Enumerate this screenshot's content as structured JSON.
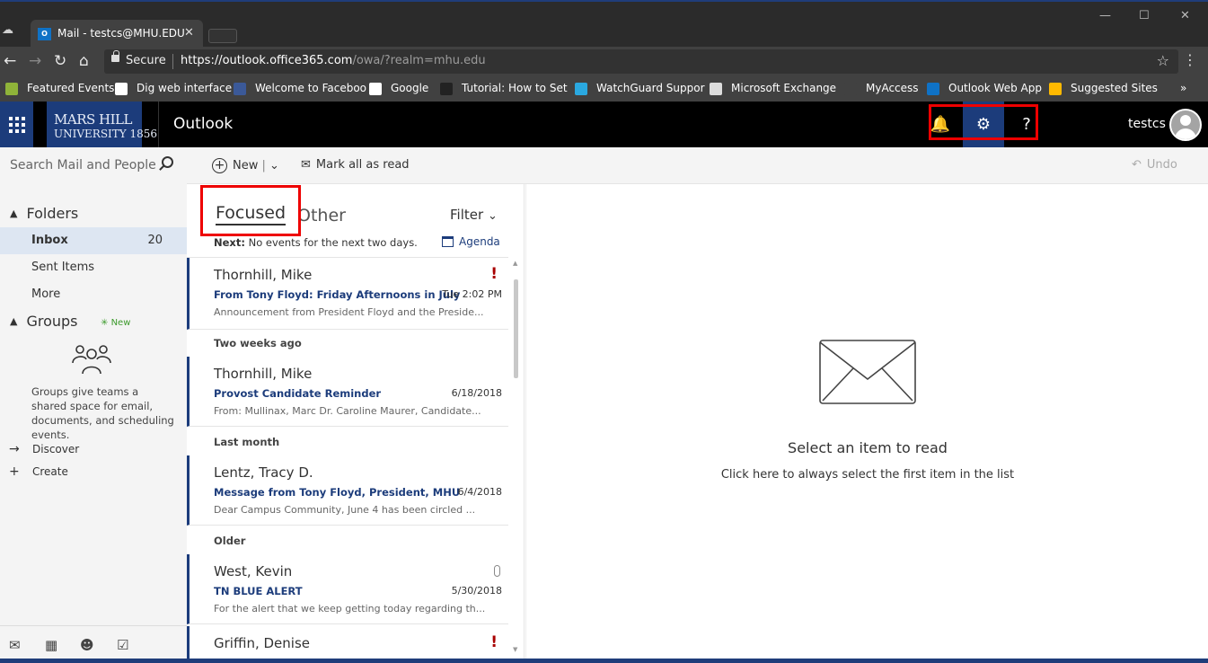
{
  "browser": {
    "tab_title": "Mail - testcs@MHU.EDU",
    "tab_favicon": "O",
    "secure_label": "Secure",
    "url_host": "https://outlook.office365.com",
    "url_path": "/owa/?realm=mhu.edu",
    "bookmarks": [
      {
        "label": "Featured Events",
        "icon": "bookmark-icon",
        "color": "#8fb339"
      },
      {
        "label": "Dig web interface",
        "icon": "dig-icon",
        "color": "#ffffff"
      },
      {
        "label": "Welcome to Faceboo",
        "icon": "facebook-icon",
        "color": "#3b5998"
      },
      {
        "label": "Google",
        "icon": "google-icon",
        "color": "#ffffff"
      },
      {
        "label": "Tutorial: How to Set",
        "icon": "tutorial-icon",
        "color": "#222222"
      },
      {
        "label": "WatchGuard Suppor",
        "icon": "cloud-icon",
        "color": "#2aa8e0"
      },
      {
        "label": "Microsoft Exchange",
        "icon": "page-icon",
        "color": "#dddddd"
      },
      {
        "label": "MyAccess",
        "icon": "myaccess-icon",
        "color": "#414141"
      },
      {
        "label": "Outlook Web App",
        "icon": "outlook-icon",
        "color": "#0f72c6"
      },
      {
        "label": "Suggested Sites",
        "icon": "bing-icon",
        "color": "#ffb900"
      }
    ],
    "more_bookmarks": "»"
  },
  "header": {
    "logo_line1": "MARS HILL",
    "logo_line2": "UNIVERSITY 1856",
    "app_name": "Outlook",
    "user_name": "testcs"
  },
  "sidebar": {
    "search_placeholder": "Search Mail and People",
    "folders_label": "Folders",
    "folders": [
      {
        "label": "Inbox",
        "count": "20"
      },
      {
        "label": "Sent Items",
        "count": ""
      },
      {
        "label": "More",
        "count": ""
      }
    ],
    "groups_label": "Groups",
    "groups_new": "New",
    "groups_text": "Groups give teams a shared space for email, documents, and scheduling events.",
    "discover_label": "Discover",
    "create_label": "Create"
  },
  "toolbar": {
    "new_label": "New",
    "mark_all_read": "Mark all as read",
    "undo": "Undo"
  },
  "list": {
    "focused_tab": "Focused",
    "other_tab": "Other",
    "filter_label": "Filter",
    "next_label": "Next:",
    "next_text": "No events for the next two days.",
    "agenda_label": "Agenda",
    "groups": [
      "Two weeks ago",
      "Last month",
      "Older"
    ],
    "messages": [
      {
        "sender": "Thornhill, Mike",
        "subject": "From Tony Floyd: Friday Afternoons in July",
        "date": "Tue 2:02 PM",
        "preview": "Announcement from President Floyd and the Preside...",
        "flag": "!"
      },
      {
        "sender": "Thornhill, Mike",
        "subject": "Provost Candidate Reminder",
        "date": "6/18/2018",
        "preview": "From: Mullinax, Marc  Dr. Caroline Maurer, Candidate...",
        "flag": ""
      },
      {
        "sender": "Lentz, Tracy D.",
        "subject": "Message from Tony Floyd, President, MHU",
        "date": "6/4/2018",
        "preview": "Dear Campus Community,    June 4 has been circled ...",
        "flag": ""
      },
      {
        "sender": "West, Kevin",
        "subject": "TN BLUE ALERT",
        "date": "5/30/2018",
        "preview": "For the alert that we keep getting today regarding th...",
        "flag": ""
      },
      {
        "sender": "Griffin, Denise",
        "subject": "",
        "date": "",
        "preview": "",
        "flag": "!"
      }
    ]
  },
  "reading": {
    "title": "Select an item to read",
    "link": "Click here to always select the first item in the list"
  },
  "colors": {
    "brand": "#1c3c7b",
    "highlight": "#e00000",
    "important": "#a80000"
  }
}
